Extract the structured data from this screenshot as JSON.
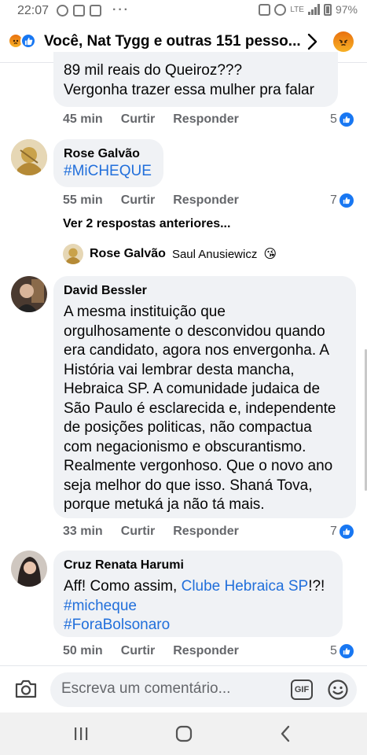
{
  "status_bar": {
    "time": "22:07",
    "battery": "97%",
    "network": "LTE"
  },
  "header": {
    "title": "Você, Nat Tygg e outras 151 pesso..."
  },
  "comments": [
    {
      "text_lines": [
        "89 mil reais do Queiroz???",
        "Vergonha trazer essa mulher pra falar"
      ],
      "time": "45 min",
      "like_label": "Curtir",
      "reply_label": "Responder",
      "likes": "5"
    },
    {
      "author": "Rose Galvão",
      "text": "#MiCHEQUE",
      "time": "55 min",
      "like_label": "Curtir",
      "reply_label": "Responder",
      "likes": "7"
    },
    {
      "author": "David Bessler",
      "text_lines": [
        "A mesma instituição que",
        "orgulhosamente o desconvidou quando",
        "era candidato, agora nos envergonha. A",
        "História vai lembrar desta mancha,",
        "Hebraica SP. A comunidade judaica de",
        "São Paulo é esclarecida e, independente",
        "de posições politicas, não compactua",
        "com negacionismo e obscurantismo.",
        "Realmente vergonhoso. Que o novo ano",
        "seja melhor do que isso. Shaná Tova,",
        "porque metuká ja não tá mais."
      ],
      "time": "33 min",
      "like_label": "Curtir",
      "reply_label": "Responder",
      "likes": "7"
    },
    {
      "author": "Cruz Renata Harumi",
      "text_prefix": "Aff! Como assim, ",
      "mention": "Clube Hebraica SP",
      "text_suffix": "!?!",
      "hashtags": [
        "#micheque",
        "#ForaBolsonaro"
      ],
      "time": "50 min",
      "like_label": "Curtir",
      "reply_label": "Responder",
      "likes": "5"
    }
  ],
  "view_previous": "Ver 2 respostas anteriores...",
  "reply_preview": {
    "author": "Rose Galvão",
    "text": "Saul Anusiewicz",
    "emoji": "😘"
  },
  "composer": {
    "placeholder": "Escreva um comentário...",
    "gif_label": "GIF"
  },
  "colors": {
    "link": "#216fdb",
    "like_blue": "#1877f2",
    "bubble": "#f0f2f5",
    "meta": "#65676b"
  }
}
